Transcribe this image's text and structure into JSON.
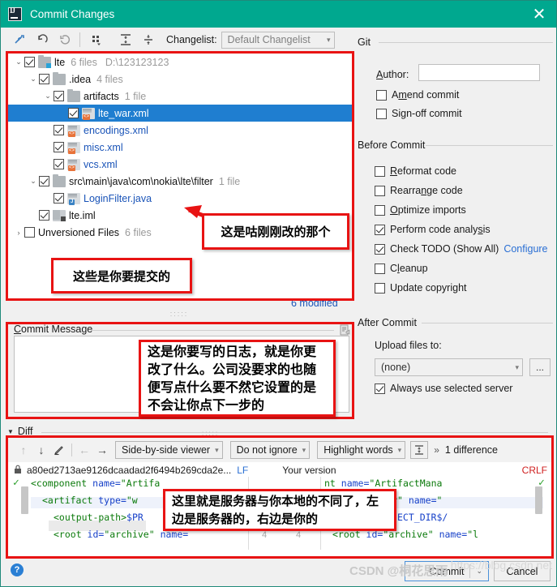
{
  "window": {
    "title": "Commit Changes",
    "close_label": "✕",
    "logo": "intellij-idea-logo"
  },
  "toolbar": {
    "icons": [
      "collapse-selection-icon",
      "revert-icon",
      "refresh-icon",
      "group-by-icon",
      "expand-all-icon",
      "collapse-all-icon"
    ],
    "changelist_label": "Changelist:",
    "changelist_value": "Default Changelist"
  },
  "tree": {
    "rows": [
      {
        "indent": 0,
        "arrow": "⌄",
        "checked": true,
        "icon": "folder-module-icon",
        "label": "lte",
        "meta": "6 files",
        "path": "D:\\123123123",
        "selected": false,
        "link": false
      },
      {
        "indent": 1,
        "arrow": "⌄",
        "checked": true,
        "icon": "folder-icon",
        "label": ".idea",
        "meta": "4 files",
        "path": "",
        "selected": false,
        "link": false
      },
      {
        "indent": 2,
        "arrow": "⌄",
        "checked": true,
        "icon": "folder-icon",
        "label": "artifacts",
        "meta": "1 file",
        "path": "",
        "selected": false,
        "link": false
      },
      {
        "indent": 3,
        "arrow": "",
        "checked": true,
        "icon": "xml-file-icon",
        "label": "lte_war.xml",
        "meta": "",
        "path": "",
        "selected": true,
        "link": true
      },
      {
        "indent": 2,
        "arrow": "",
        "checked": true,
        "icon": "xml-file-icon",
        "label": "encodings.xml",
        "meta": "",
        "path": "",
        "selected": false,
        "link": true
      },
      {
        "indent": 2,
        "arrow": "",
        "checked": true,
        "icon": "xml-file-icon",
        "label": "misc.xml",
        "meta": "",
        "path": "",
        "selected": false,
        "link": true
      },
      {
        "indent": 2,
        "arrow": "",
        "checked": true,
        "icon": "xml-file-icon",
        "label": "vcs.xml",
        "meta": "",
        "path": "",
        "selected": false,
        "link": true
      },
      {
        "indent": 1,
        "arrow": "⌄",
        "checked": true,
        "icon": "folder-icon",
        "label": "src\\main\\java\\com\\nokia\\lte\\filter",
        "meta": "1 file",
        "path": "",
        "selected": false,
        "link": false
      },
      {
        "indent": 2,
        "arrow": "",
        "checked": true,
        "icon": "java-file-icon",
        "label": "LoginFilter.java",
        "meta": "",
        "path": "",
        "selected": false,
        "link": true
      },
      {
        "indent": 1,
        "arrow": "",
        "checked": true,
        "icon": "iml-file-icon",
        "label": "lte.iml",
        "meta": "",
        "path": "",
        "selected": false,
        "link": false
      },
      {
        "indent": 0,
        "arrow": "›",
        "checked": false,
        "icon": "",
        "label": "Unversioned Files",
        "meta": "6 files",
        "path": "",
        "selected": false,
        "link": false
      }
    ],
    "modified_count": "6 modified"
  },
  "commit_message": {
    "title": "Commit Message",
    "title_mnemonic": "C",
    "value": "",
    "history_icon": "message-history-icon"
  },
  "git_panel": {
    "group_git": "Git",
    "author_label": "Author:",
    "author_mnemonic": "A",
    "author_value": "",
    "checkboxes_git": [
      {
        "label": "Amend commit",
        "mnemonic": "m",
        "checked": false
      },
      {
        "label": "Sign-off commit",
        "mnemonic": "g",
        "checked": false
      }
    ],
    "group_before": "Before Commit",
    "checkboxes_before": [
      {
        "label": "Reformat code",
        "mnemonic": "R",
        "checked": false,
        "link": ""
      },
      {
        "label": "Rearrange code",
        "mnemonic": "n",
        "checked": false,
        "link": ""
      },
      {
        "label": "Optimize imports",
        "mnemonic": "O",
        "checked": false,
        "link": ""
      },
      {
        "label": "Perform code analysis",
        "mnemonic": "s",
        "checked": true,
        "link": ""
      },
      {
        "label": "Check TODO (Show All)",
        "mnemonic": "",
        "checked": true,
        "link": "Configure"
      },
      {
        "label": "Cleanup",
        "mnemonic": "l",
        "checked": false,
        "link": ""
      },
      {
        "label": "Update copyright",
        "mnemonic": "",
        "checked": false,
        "link": ""
      }
    ],
    "group_after": "After Commit",
    "upload_label": "Upload files to:",
    "upload_value": "(none)",
    "browse_button": "...",
    "always_use_label": "Always use selected server",
    "always_use_checked": true
  },
  "diff": {
    "section_label": "Diff",
    "toolbar": {
      "prev_diff_icon": "arrow-up-icon",
      "next_diff_icon": "arrow-down-icon",
      "edit_icon": "pencil-icon",
      "left_icon": "arrow-left-icon",
      "right_icon": "arrow-right-icon",
      "viewer_mode": "Side-by-side viewer",
      "ignore_mode": "Do not ignore",
      "highlight_mode": "Highlight words",
      "collapse_icon": "collapse-unchanged-icon",
      "more_icon": "»",
      "difference_count": "1 difference"
    },
    "left_title": "a80ed2713ae9126dcaadad2f6494b269cda2e...",
    "left_lineending": "LF",
    "right_title": "Your version",
    "right_lineending": "CRLF",
    "lock_icon": "lock-icon",
    "left_lines": [
      "<component name=\"Artifa",
      "  <artifact type=\"w",
      "    <output-path>$PR",
      "    <root id=\"archive\" name="
    ],
    "right_lines": [
      "nt name=\"ArtifactMana",
      "act type=\"war\" name=\"",
      "ut-path>$PROJECT_DIR$/",
      "<root id=\"archive\" name=\"l"
    ],
    "gutter_numbers": [
      "4",
      "4"
    ]
  },
  "bottom": {
    "help_icon": "help-icon",
    "commit_label": "Commit",
    "commit_caret": "⌄",
    "cancel_label": "Cancel"
  },
  "annotations": {
    "callout_tree_file": "这是咕刚刚改的那个",
    "callout_tree_commit": "这些是你要提交的",
    "callout_message": "这是你要写的日志，就是你更改了什么。公司没要求的也随便写点什么要不然它设置的是不会让你点下一步的",
    "callout_diff": "这里就是服务器与你本地的不同了，左边是服务器的，右边是你的",
    "accent_red": "#e81313"
  },
  "watermark": {
    "url": "https://blog.csdn.net",
    "author": "CSDN @桐花思雨"
  }
}
